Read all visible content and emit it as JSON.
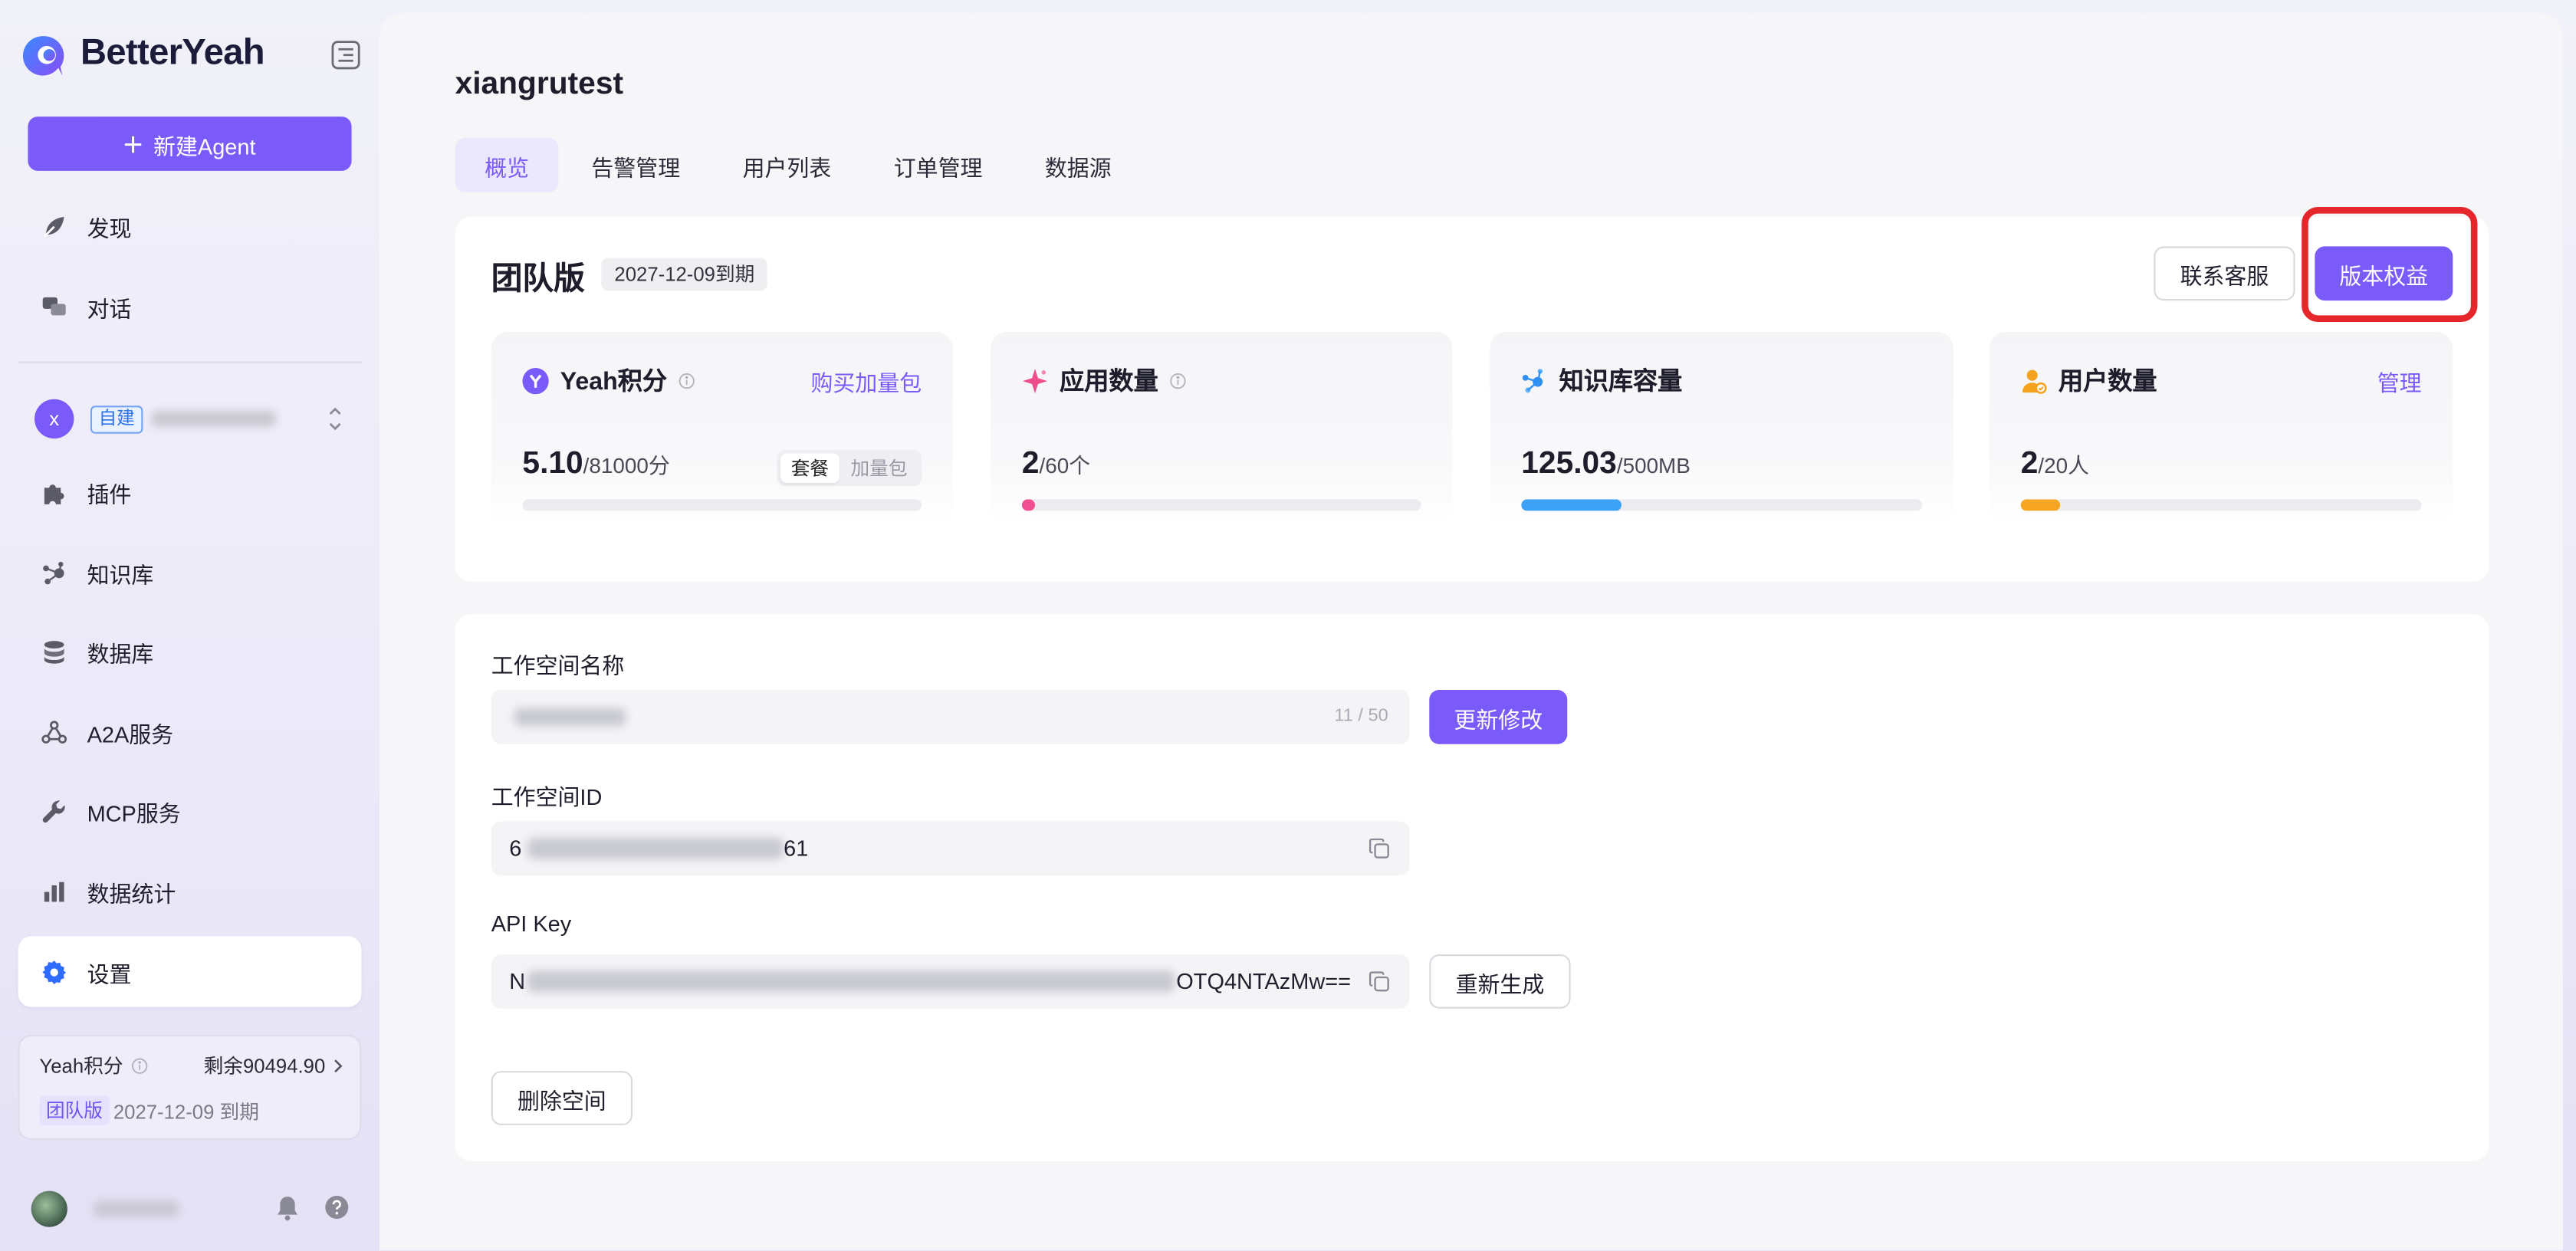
{
  "app": {
    "brand": "BetterYeah"
  },
  "colors": {
    "accent": "#7a5af8",
    "highlight": "#e5262b",
    "settings_icon": "#2f6bff"
  },
  "sidebar": {
    "new_agent_label": "新建Agent",
    "top_items": [
      {
        "label": "发现",
        "icon": "discover-icon"
      },
      {
        "label": "对话",
        "icon": "chat-icon"
      }
    ],
    "workspace": {
      "avatar_letter": "x",
      "badge": "自建"
    },
    "items": [
      {
        "label": "插件",
        "icon": "puzzle-icon"
      },
      {
        "label": "知识库",
        "icon": "knowledge-icon"
      },
      {
        "label": "数据库",
        "icon": "database-icon"
      },
      {
        "label": "A2A服务",
        "icon": "a2a-icon"
      },
      {
        "label": "MCP服务",
        "icon": "wrench-icon"
      },
      {
        "label": "数据统计",
        "icon": "bar-chart-icon"
      },
      {
        "label": "设置",
        "icon": "gear-icon",
        "selected": true
      }
    ],
    "credits": {
      "label": "Yeah积分",
      "remaining": "剩余90494.90",
      "plan": "团队版",
      "expiry": "2027-12-09 到期"
    }
  },
  "main": {
    "title": "xiangrutest",
    "tabs": [
      {
        "label": "概览",
        "active": true
      },
      {
        "label": "告警管理"
      },
      {
        "label": "用户列表"
      },
      {
        "label": "订单管理"
      },
      {
        "label": "数据源"
      }
    ],
    "plan": {
      "name": "团队版",
      "expiry": "2027-12-09到期",
      "contact_label": "联系客服",
      "benefits_label": "版本权益"
    },
    "stats": [
      {
        "title": "Yeah积分",
        "value": "5.10",
        "unit": "/81000分",
        "action": "购买加量包",
        "toggle": [
          "套餐",
          "加量包"
        ],
        "progress": 0.0001,
        "color": "#7a5af8",
        "icon": "yeah-credit-icon"
      },
      {
        "title": "应用数量",
        "value": "2",
        "unit": "/60个",
        "progress": 0.033,
        "color": "#f0508f",
        "icon": "sparkle-icon"
      },
      {
        "title": "知识库容量",
        "value": "125.03",
        "unit": "/500MB",
        "progress": 0.25,
        "color": "#3ba2f7",
        "icon": "network-icon"
      },
      {
        "title": "用户数量",
        "value": "2",
        "unit": "/20人",
        "action": "管理",
        "progress": 0.1,
        "color": "#f6a623",
        "icon": "user-icon"
      }
    ],
    "form": {
      "name_label": "工作空间名称",
      "name_counter": "11 / 50",
      "update_label": "更新修改",
      "id_label": "工作空间ID",
      "id_prefix": "6",
      "id_suffix": "61",
      "apikey_label": "API Key",
      "apikey_prefix": "N",
      "apikey_suffix": "OTQ4NTAzMw==",
      "regenerate_label": "重新生成",
      "delete_label": "删除空间"
    }
  }
}
